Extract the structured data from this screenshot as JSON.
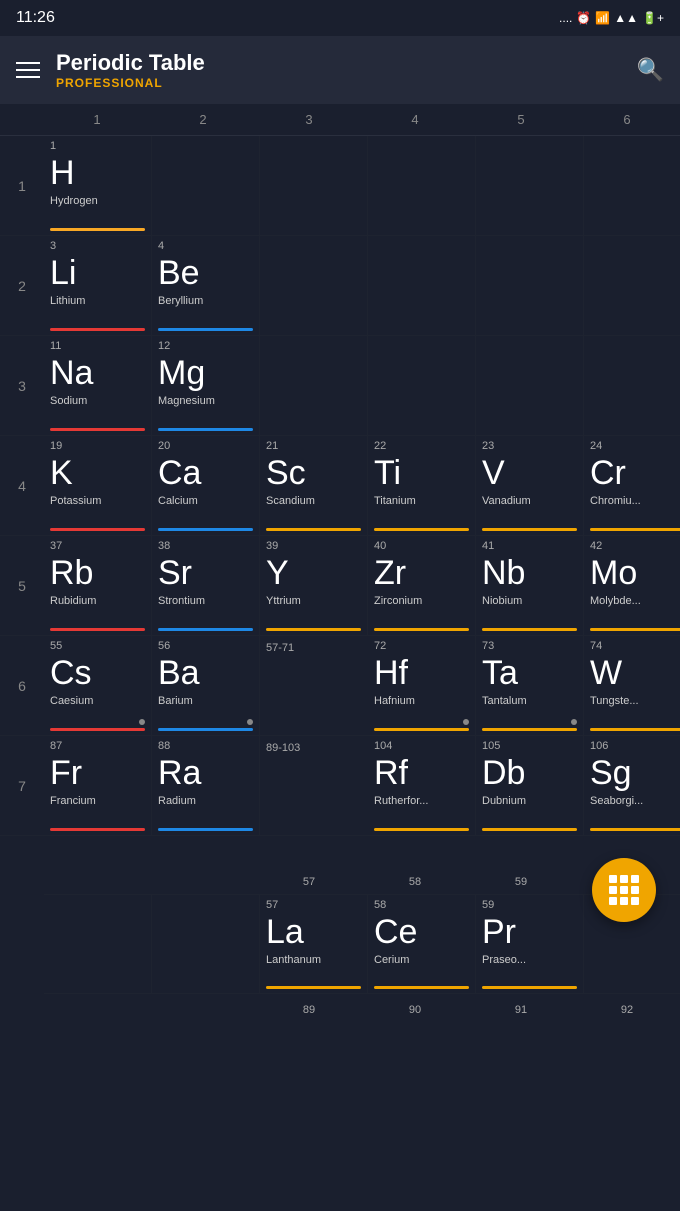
{
  "statusBar": {
    "time": "11:26",
    "icons": ".... ⏰ 📶 ▲ 🔋"
  },
  "header": {
    "title": "Periodic Table",
    "subtitle": "PROFESSIONAL",
    "menuLabel": "Menu",
    "searchLabel": "Search"
  },
  "colNumbers": [
    "1",
    "2",
    "3",
    "4",
    "5",
    "6"
  ],
  "rows": [
    {
      "rowNum": "",
      "cells": [
        {
          "number": "1",
          "symbol": "H",
          "name": "Hydrogen",
          "underline": "yellow",
          "col": 1
        },
        {
          "number": "",
          "symbol": "",
          "name": "",
          "underline": "",
          "col": 2
        },
        {
          "number": "",
          "symbol": "",
          "name": "",
          "underline": "",
          "col": 3
        },
        {
          "number": "",
          "symbol": "",
          "name": "",
          "underline": "",
          "col": 4
        },
        {
          "number": "",
          "symbol": "",
          "name": "",
          "underline": "",
          "col": 5
        },
        {
          "number": "",
          "symbol": "",
          "name": "",
          "underline": "",
          "col": 6
        }
      ]
    }
  ],
  "periodicRows": [
    {
      "rowNum": "1",
      "subRowNum": "1",
      "elements": [
        {
          "number": "1",
          "symbol": "H",
          "name": "Hydrogen",
          "underline": "yellow"
        },
        null,
        null,
        null,
        null,
        null
      ]
    },
    {
      "rowNum": "2",
      "elements": [
        {
          "number": "3",
          "symbol": "Li",
          "name": "Lithium",
          "underline": "red"
        },
        {
          "number": "4",
          "symbol": "Be",
          "name": "Beryllium",
          "underline": "blue"
        },
        null,
        null,
        null,
        null
      ]
    },
    {
      "rowNum": "3",
      "elements": [
        {
          "number": "11",
          "symbol": "Na",
          "name": "Sodium",
          "underline": "red"
        },
        {
          "number": "12",
          "symbol": "Mg",
          "name": "Magnesium",
          "underline": "blue"
        },
        null,
        null,
        null,
        null
      ]
    },
    {
      "rowNum": "4",
      "elements": [
        {
          "number": "19",
          "symbol": "K",
          "name": "Potassium",
          "underline": "red"
        },
        {
          "number": "20",
          "symbol": "Ca",
          "name": "Calcium",
          "underline": "blue"
        },
        {
          "number": "21",
          "symbol": "Sc",
          "name": "Scandium",
          "underline": "orange"
        },
        {
          "number": "22",
          "symbol": "Ti",
          "name": "Titanium",
          "underline": "orange"
        },
        {
          "number": "23",
          "symbol": "V",
          "name": "Vanadium",
          "underline": "orange"
        },
        {
          "number": "24",
          "symbol": "Cr",
          "name": "Chromiu...",
          "underline": "orange"
        }
      ]
    },
    {
      "rowNum": "5",
      "elements": [
        {
          "number": "37",
          "symbol": "Rb",
          "name": "Rubidium",
          "underline": "red"
        },
        {
          "number": "38",
          "symbol": "Sr",
          "name": "Strontium",
          "underline": "blue"
        },
        {
          "number": "39",
          "symbol": "Y",
          "name": "Yttrium",
          "underline": "orange"
        },
        {
          "number": "40",
          "symbol": "Zr",
          "name": "Zirconium",
          "underline": "orange"
        },
        {
          "number": "41",
          "symbol": "Nb",
          "name": "Niobium",
          "underline": "orange"
        },
        {
          "number": "42",
          "symbol": "Mo",
          "name": "Molybde...",
          "underline": "orange"
        }
      ]
    },
    {
      "rowNum": "6",
      "elements": [
        {
          "number": "55",
          "symbol": "Cs",
          "name": "Caesium",
          "underline": "red"
        },
        {
          "number": "56",
          "symbol": "Ba",
          "name": "Barium",
          "underline": "blue"
        },
        {
          "number": "57-71",
          "symbol": "",
          "name": "",
          "underline": "",
          "isRange": true
        },
        {
          "number": "72",
          "symbol": "Hf",
          "name": "Hafnium",
          "underline": "orange"
        },
        {
          "number": "73",
          "symbol": "Ta",
          "name": "Tantalum",
          "underline": "orange"
        },
        {
          "number": "74",
          "symbol": "W",
          "name": "Tungste...",
          "underline": "orange"
        }
      ]
    },
    {
      "rowNum": "7",
      "elements": [
        {
          "number": "87",
          "symbol": "Fr",
          "name": "Francium",
          "underline": "red"
        },
        {
          "number": "88",
          "symbol": "Ra",
          "name": "Radium",
          "underline": "blue"
        },
        {
          "number": "89-103",
          "symbol": "",
          "name": "",
          "underline": "",
          "isRange": true
        },
        {
          "number": "104",
          "symbol": "Rf",
          "name": "Rutherfor...",
          "underline": "orange"
        },
        {
          "number": "105",
          "symbol": "Db",
          "name": "Dubnium",
          "underline": "orange"
        },
        {
          "number": "106",
          "symbol": "Sg",
          "name": "Seaborgi...",
          "underline": "orange"
        }
      ]
    }
  ],
  "bottomRowNumbers": [
    "57",
    "58",
    "59",
    "",
    ""
  ],
  "lanthanideRow": [
    {
      "number": "57",
      "symbol": "La",
      "name": "Lanthanum",
      "underline": "orange"
    },
    {
      "number": "58",
      "symbol": "Ce",
      "name": "Cerium",
      "underline": "orange"
    },
    {
      "number": "59",
      "symbol": "Pr",
      "name": "Praseo...",
      "underline": "orange"
    },
    null
  ],
  "actinideRowNumbers": [
    "89",
    "90",
    "91",
    "92"
  ],
  "fab": {
    "label": "Grid view"
  }
}
